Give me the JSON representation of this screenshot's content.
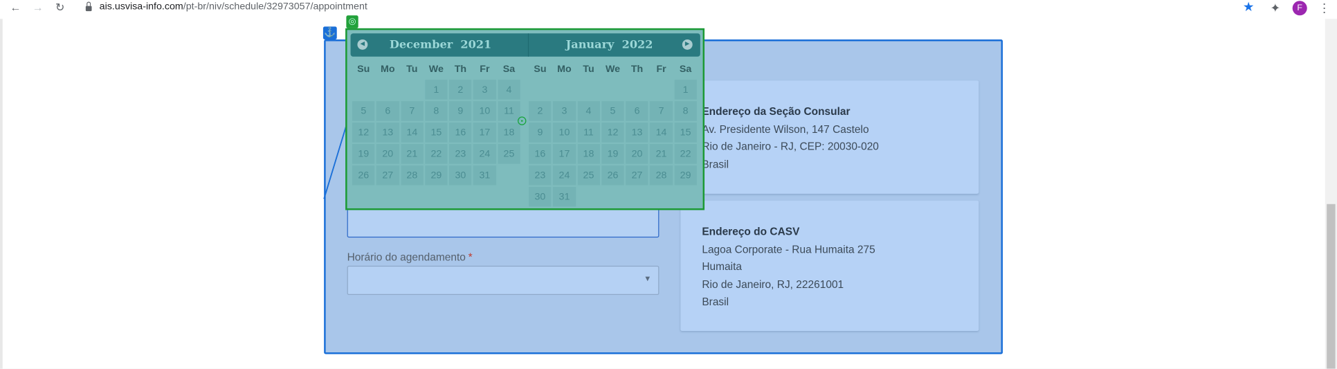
{
  "browser": {
    "url_host": "ais.usvisa-info.com",
    "url_path": "/pt-br/niv/schedule/32973057/appointment",
    "avatar_letter": "F"
  },
  "form": {
    "time_label": "Horário do agendamento",
    "required_mark": "*"
  },
  "consular_address": {
    "title": "Endereço da Seção Consular",
    "lines": [
      "Av. Presidente Wilson, 147 Castelo",
      "Rio de Janeiro - RJ, CEP: 20030-020",
      "Brasil"
    ]
  },
  "casv_address": {
    "title": "Endereço do CASV",
    "lines": [
      "Lagoa Corporate - Rua Humaita 275",
      "Humaita",
      "Rio de Janeiro, RJ, 22261001",
      "Brasil"
    ]
  },
  "datepicker": {
    "weekdays": [
      "Su",
      "Mo",
      "Tu",
      "We",
      "Th",
      "Fr",
      "Sa"
    ],
    "months": [
      {
        "name": "December",
        "year": "2021",
        "weeks": [
          [
            "",
            "",
            "",
            "1",
            "2",
            "3",
            "4"
          ],
          [
            "5",
            "6",
            "7",
            "8",
            "9",
            "10",
            "11"
          ],
          [
            "12",
            "13",
            "14",
            "15",
            "16",
            "17",
            "18"
          ],
          [
            "19",
            "20",
            "21",
            "22",
            "23",
            "24",
            "25"
          ],
          [
            "26",
            "27",
            "28",
            "29",
            "30",
            "31",
            ""
          ]
        ]
      },
      {
        "name": "January",
        "year": "2022",
        "weeks": [
          [
            "",
            "",
            "",
            "",
            "",
            "",
            "1"
          ],
          [
            "2",
            "3",
            "4",
            "5",
            "6",
            "7",
            "8"
          ],
          [
            "9",
            "10",
            "11",
            "12",
            "13",
            "14",
            "15"
          ],
          [
            "16",
            "17",
            "18",
            "19",
            "20",
            "21",
            "22"
          ],
          [
            "23",
            "24",
            "25",
            "26",
            "27",
            "28",
            "29"
          ],
          [
            "30",
            "31",
            "",
            "",
            "",
            "",
            ""
          ]
        ]
      }
    ]
  },
  "colors": {
    "panel_overlay": "#a9c6ea",
    "panel_border": "#1a6fd8",
    "datepicker_overlay": "#7ebcbd",
    "datepicker_border": "#1c9a34",
    "star": "#1a73e8",
    "avatar": "#9c27b0"
  },
  "icons": [
    "back-arrow-icon",
    "forward-arrow-icon",
    "reload-icon",
    "lock-icon",
    "star-icon",
    "puzzle-extension-icon",
    "kebab-menu-icon",
    "anchor-icon",
    "target-icon",
    "chevron-left-icon",
    "chevron-right-icon",
    "dropdown-arrow-icon"
  ]
}
